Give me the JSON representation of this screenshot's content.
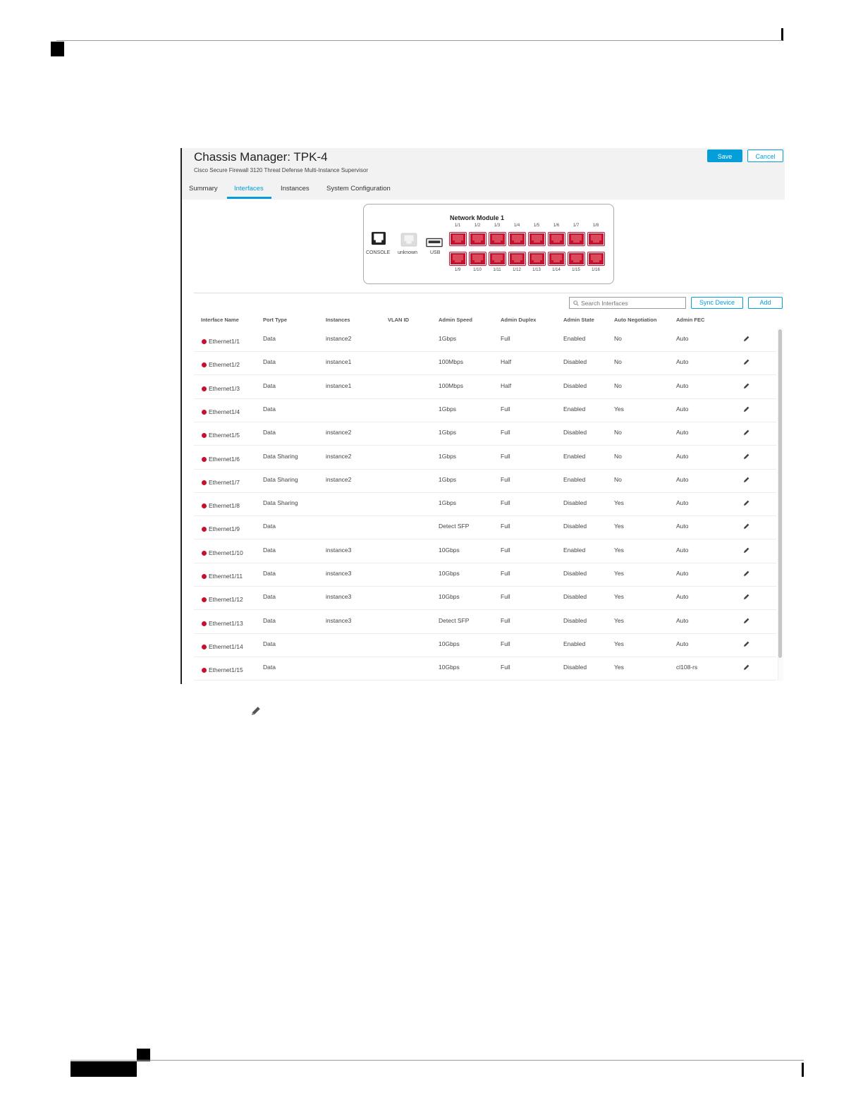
{
  "header": {
    "title": "Chassis Manager: TPK-4",
    "subtitle": "Cisco Secure Firewall 3120 Threat Defense Multi-Instance Supervisor",
    "save_label": "Save",
    "cancel_label": "Cancel"
  },
  "tabs": [
    {
      "label": "Summary"
    },
    {
      "label": "Interfaces",
      "active": true
    },
    {
      "label": "Instances"
    },
    {
      "label": "System Configuration"
    }
  ],
  "module": {
    "title": "Network Module 1",
    "mgmt": {
      "console": "CONSOLE",
      "unknown": "unknown",
      "usb": "USB"
    },
    "top_ports": [
      "1/1",
      "1/2",
      "1/3",
      "1/4",
      "1/5",
      "1/6",
      "1/7",
      "1/8"
    ],
    "bottom_ports": [
      "1/9",
      "1/10",
      "1/11",
      "1/12",
      "1/13",
      "1/14",
      "1/15",
      "1/16"
    ]
  },
  "toolbar": {
    "search_placeholder": "Search Interfaces",
    "sync_label": "Sync Device",
    "add_label": "Add"
  },
  "table": {
    "columns": [
      "Interface Name",
      "Port Type",
      "Instances",
      "VLAN ID",
      "Admin Speed",
      "Admin Duplex",
      "Admin State",
      "Auto Negotiation",
      "Admin FEC"
    ],
    "rows": [
      {
        "name": "Ethernet1/1",
        "port_type": "Data",
        "instances": "instance2",
        "vlan": "",
        "speed": "1Gbps",
        "duplex": "Full",
        "state": "Enabled",
        "autoneg": "No",
        "fec": "Auto"
      },
      {
        "name": "Ethernet1/2",
        "port_type": "Data",
        "instances": "instance1",
        "vlan": "",
        "speed": "100Mbps",
        "duplex": "Half",
        "state": "Disabled",
        "autoneg": "No",
        "fec": "Auto"
      },
      {
        "name": "Ethernet1/3",
        "port_type": "Data",
        "instances": "instance1",
        "vlan": "",
        "speed": "100Mbps",
        "duplex": "Half",
        "state": "Disabled",
        "autoneg": "No",
        "fec": "Auto"
      },
      {
        "name": "Ethernet1/4",
        "port_type": "Data",
        "instances": "",
        "vlan": "",
        "speed": "1Gbps",
        "duplex": "Full",
        "state": "Enabled",
        "autoneg": "Yes",
        "fec": "Auto"
      },
      {
        "name": "Ethernet1/5",
        "port_type": "Data",
        "instances": "instance2",
        "vlan": "",
        "speed": "1Gbps",
        "duplex": "Full",
        "state": "Disabled",
        "autoneg": "No",
        "fec": "Auto"
      },
      {
        "name": "Ethernet1/6",
        "port_type": "Data Sharing",
        "instances": "instance2",
        "vlan": "",
        "speed": "1Gbps",
        "duplex": "Full",
        "state": "Enabled",
        "autoneg": "No",
        "fec": "Auto"
      },
      {
        "name": "Ethernet1/7",
        "port_type": "Data Sharing",
        "instances": "instance2",
        "vlan": "",
        "speed": "1Gbps",
        "duplex": "Full",
        "state": "Enabled",
        "autoneg": "No",
        "fec": "Auto"
      },
      {
        "name": "Ethernet1/8",
        "port_type": "Data Sharing",
        "instances": "",
        "vlan": "",
        "speed": "1Gbps",
        "duplex": "Full",
        "state": "Disabled",
        "autoneg": "Yes",
        "fec": "Auto"
      },
      {
        "name": "Ethernet1/9",
        "port_type": "Data",
        "instances": "",
        "vlan": "",
        "speed": "Detect SFP",
        "duplex": "Full",
        "state": "Disabled",
        "autoneg": "Yes",
        "fec": "Auto"
      },
      {
        "name": "Ethernet1/10",
        "port_type": "Data",
        "instances": "instance3",
        "vlan": "",
        "speed": "10Gbps",
        "duplex": "Full",
        "state": "Enabled",
        "autoneg": "Yes",
        "fec": "Auto"
      },
      {
        "name": "Ethernet1/11",
        "port_type": "Data",
        "instances": "instance3",
        "vlan": "",
        "speed": "10Gbps",
        "duplex": "Full",
        "state": "Disabled",
        "autoneg": "Yes",
        "fec": "Auto"
      },
      {
        "name": "Ethernet1/12",
        "port_type": "Data",
        "instances": "instance3",
        "vlan": "",
        "speed": "10Gbps",
        "duplex": "Full",
        "state": "Disabled",
        "autoneg": "Yes",
        "fec": "Auto"
      },
      {
        "name": "Ethernet1/13",
        "port_type": "Data",
        "instances": "instance3",
        "vlan": "",
        "speed": "Detect SFP",
        "duplex": "Full",
        "state": "Disabled",
        "autoneg": "Yes",
        "fec": "Auto"
      },
      {
        "name": "Ethernet1/14",
        "port_type": "Data",
        "instances": "",
        "vlan": "",
        "speed": "10Gbps",
        "duplex": "Full",
        "state": "Enabled",
        "autoneg": "Yes",
        "fec": "Auto"
      },
      {
        "name": "Ethernet1/15",
        "port_type": "Data",
        "instances": "",
        "vlan": "",
        "speed": "10Gbps",
        "duplex": "Full",
        "state": "Disabled",
        "autoneg": "Yes",
        "fec": "cl108-rs"
      }
    ]
  },
  "icons": {
    "edit": "pencil-icon",
    "search": "search-icon",
    "status": "status-dot-icon"
  },
  "colors": {
    "accent": "#049fd9",
    "port_red": "#c8102e",
    "status_down": "#c8102e"
  }
}
